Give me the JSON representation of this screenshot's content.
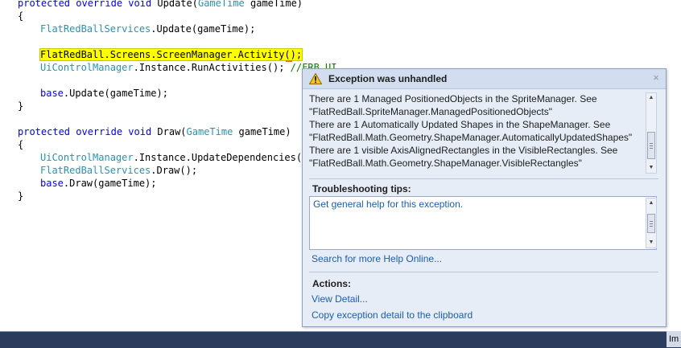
{
  "editor": {
    "lines": [
      {
        "t1": "protected override void",
        "t2": "Update(",
        "t3": "GameTime",
        "t4": " gameTime)"
      },
      {
        "text": "{"
      },
      {
        "t3": "FlatRedBallServices",
        "t4": ".Update(gameTime);"
      },
      {
        "text": ""
      },
      {
        "highlight": "FlatRedBall.Screens.ScreenManager.Activity();"
      },
      {
        "t3": "UiControlManager",
        "t4": ".Instance.RunActivities(); ",
        "comment": "//FRB_UI"
      },
      {
        "text": ""
      },
      {
        "t4": "base",
        "t5": ".Update(gameTime);"
      },
      {
        "text": "}"
      },
      {
        "text": ""
      },
      {
        "t1": "protected override void",
        "t2": "Draw(",
        "t3": "GameTime",
        "t4": " gameTime)"
      },
      {
        "text": "{"
      },
      {
        "t3": "UiControlManager",
        "t4": ".Instance.UpdateDependencies();"
      },
      {
        "t3": "FlatRedBallServices",
        "t4": ".Draw();"
      },
      {
        "t4": "base",
        "t5": ".Draw(gameTime);"
      },
      {
        "text": "}"
      }
    ]
  },
  "exception": {
    "title": "Exception was unhandled",
    "close_glyph": "×",
    "message_lines": [
      "There are 1 Managed PositionedObjects in the SpriteManager.  See",
      "\"FlatRedBall.SpriteManager.ManagedPositionedObjects\"",
      "There are 1 Automatically Updated Shapes in the ShapeManager.  See",
      "\"FlatRedBall.Math.Geometry.ShapeManager.AutomaticallyUpdatedShapes\"",
      "There are 1 visible AxisAlignedRectangles in the VisibleRectangles.  See",
      "\"FlatRedBall.Math.Geometry.ShapeManager.VisibleRectangles\""
    ],
    "tips_label": "Troubleshooting tips:",
    "tips": [
      "Get general help for this exception."
    ],
    "search_link": "Search for more Help Online...",
    "actions_label": "Actions:",
    "actions": [
      "View Detail...",
      "Copy exception detail to the clipboard"
    ]
  },
  "statusbar": {
    "tab_text": "Im"
  },
  "colors": {
    "keyword": "#0000ff",
    "type": "#2b91af",
    "comment": "#008000",
    "highlight": "#ffff00",
    "link": "#1c5eab",
    "dialog_bg": "#e6edf7"
  },
  "icons": {
    "warning": "warning-icon",
    "close": "close-icon"
  }
}
